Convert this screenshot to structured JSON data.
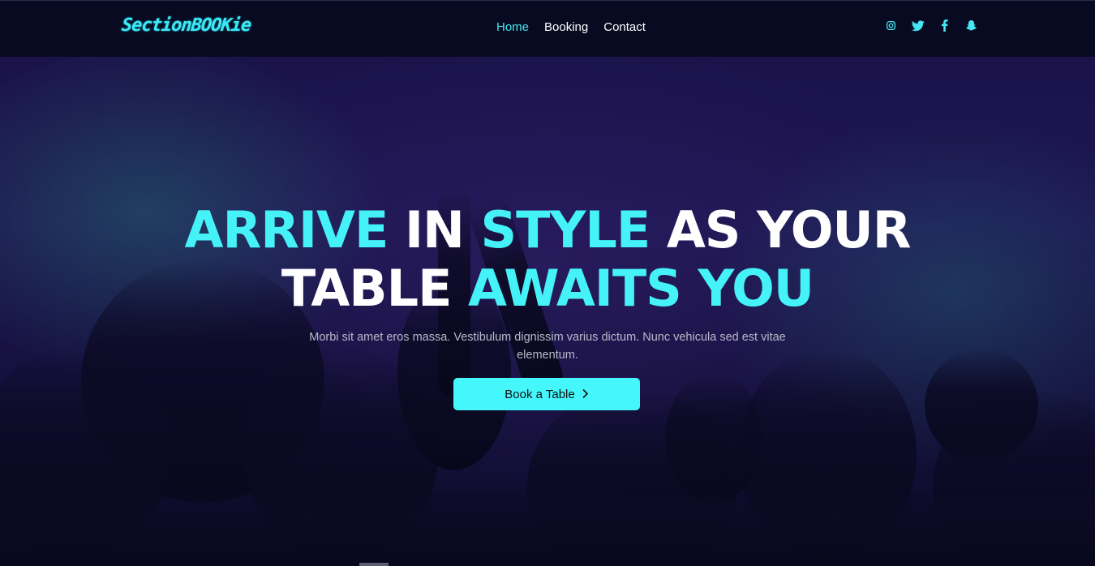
{
  "brand": {
    "logo_text": "SectionBOOKie",
    "accent_color": "#45f2f8"
  },
  "nav": {
    "items": [
      {
        "label": "Home",
        "active": true
      },
      {
        "label": "Booking",
        "active": false
      },
      {
        "label": "Contact",
        "active": false
      }
    ]
  },
  "socials": [
    {
      "icon": "instagram-icon"
    },
    {
      "icon": "twitter-icon"
    },
    {
      "icon": "facebook-icon"
    },
    {
      "icon": "snapchat-icon"
    }
  ],
  "hero": {
    "title": {
      "w1": "ARRIVE",
      "w2": "IN",
      "w3": "STYLE",
      "w4": "AS YOUR",
      "w5": "TABLE",
      "w6": "AWAITS YOU"
    },
    "subtitle": "Morbi sit amet eros massa. Vestibulum dignissim varius dictum. Nunc vehicula sed est vitae elementum.",
    "cta_label": "Book a Table",
    "cta_icon": "chevron-right-icon"
  }
}
